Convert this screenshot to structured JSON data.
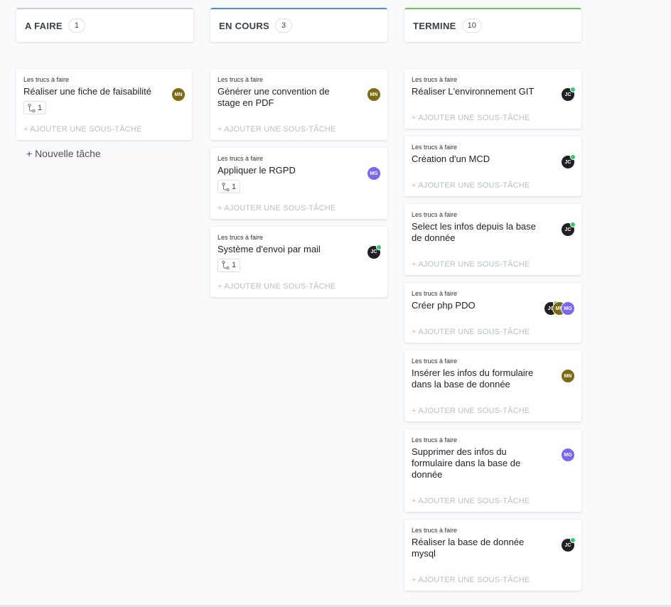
{
  "columns": [
    {
      "title": "A FAIRE",
      "count": "1",
      "accent": "#c9cdd4",
      "cards": [
        {
          "list": "Les trucs à faire",
          "title": "Réaliser une fiche de faisabilité",
          "subtasks": "1",
          "add_subtask": "+ AJOUTER UNE SOUS-TÂCHE",
          "assignees": [
            {
              "initials": "MN",
              "color": "#7d6b14",
              "online": false
            }
          ]
        }
      ],
      "new_task": "+ Nouvelle tâche"
    },
    {
      "title": "EN COURS",
      "count": "3",
      "accent": "#4a90e2",
      "cards": [
        {
          "list": "Les trucs à faire",
          "title": "Générer une convention de stage en PDF",
          "subtasks": null,
          "add_subtask": "+ AJOUTER UNE SOUS-TÂCHE",
          "assignees": [
            {
              "initials": "MN",
              "color": "#7d6b14",
              "online": false
            }
          ]
        },
        {
          "list": "Les trucs à faire",
          "title": "Appliquer le RGPD",
          "subtasks": "1",
          "add_subtask": "+ AJOUTER UNE SOUS-TÂCHE",
          "assignees": [
            {
              "initials": "MG",
              "color": "#7b68ee",
              "online": false
            }
          ]
        },
        {
          "list": "Les trucs à faire",
          "title": "Système d'envoi par mail",
          "subtasks": "1",
          "add_subtask": "+ AJOUTER UNE SOUS-TÂCHE",
          "assignees": [
            {
              "initials": "JC",
              "color": "#1f2125",
              "online": true
            }
          ]
        }
      ]
    },
    {
      "title": "TERMINE",
      "count": "10",
      "accent": "#6bc950",
      "cards": [
        {
          "list": "Les trucs à faire",
          "title": "Réaliser L'environnement GIT",
          "subtasks": null,
          "add_subtask": "+ AJOUTER UNE SOUS-TÂCHE",
          "assignees": [
            {
              "initials": "JC",
              "color": "#1f2125",
              "online": true
            }
          ]
        },
        {
          "list": "Les trucs à faire",
          "title": "Création d'un MCD",
          "subtasks": null,
          "add_subtask": "+ AJOUTER UNE SOUS-TÂCHE",
          "assignees": [
            {
              "initials": "JC",
              "color": "#1f2125",
              "online": true
            }
          ]
        },
        {
          "list": "Les trucs à faire",
          "title": "Select les infos depuis la base de donnée",
          "subtasks": null,
          "add_subtask": "+ AJOUTER UNE SOUS-TÂCHE",
          "assignees": [
            {
              "initials": "JC",
              "color": "#1f2125",
              "online": true
            }
          ]
        },
        {
          "list": "Les trucs à faire",
          "title": "Créer php PDO",
          "subtasks": null,
          "add_subtask": "+ AJOUTER UNE SOUS-TÂCHE",
          "assignees": [
            {
              "initials": "JC",
              "color": "#1f2125",
              "online": true
            },
            {
              "initials": "MN",
              "color": "#7d6b14",
              "online": false
            },
            {
              "initials": "MG",
              "color": "#7b68ee",
              "online": false
            }
          ]
        },
        {
          "list": "Les trucs à faire",
          "title": "Insérer les infos du formulaire dans la base de donnée",
          "subtasks": null,
          "add_subtask": "+ AJOUTER UNE SOUS-TÂCHE",
          "assignees": [
            {
              "initials": "MN",
              "color": "#7d6b14",
              "online": false
            }
          ]
        },
        {
          "list": "Les trucs à faire",
          "title": "Supprimer des infos du formulaire dans la base de donnée",
          "subtasks": null,
          "add_subtask": "+ AJOUTER UNE SOUS-TÂCHE",
          "assignees": [
            {
              "initials": "MG",
              "color": "#7b68ee",
              "online": false
            }
          ]
        },
        {
          "list": "Les trucs à faire",
          "title": "Réaliser la base de donnée mysql",
          "subtasks": null,
          "add_subtask": "+ AJOUTER UNE SOUS-TÂCHE",
          "assignees": [
            {
              "initials": "JC",
              "color": "#1f2125",
              "online": true
            }
          ]
        }
      ]
    }
  ]
}
